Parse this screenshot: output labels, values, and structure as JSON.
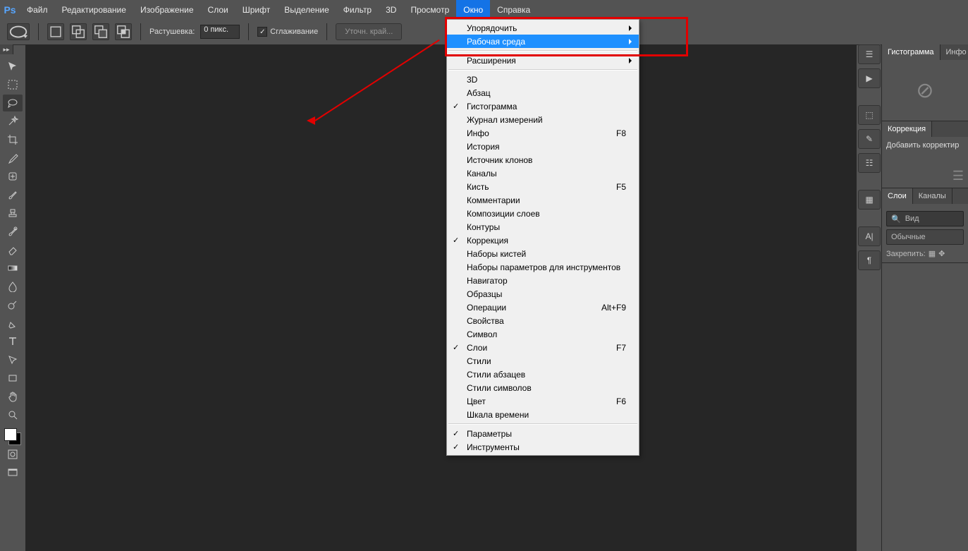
{
  "app_logo": "Ps",
  "menubar": [
    "Файл",
    "Редактирование",
    "Изображение",
    "Слои",
    "Шрифт",
    "Выделение",
    "Фильтр",
    "3D",
    "Просмотр",
    "Окно",
    "Справка"
  ],
  "menubar_active": "Окно",
  "options": {
    "feather_label": "Растушевка:",
    "feather_value": "0 пикс.",
    "antialias_label": "Сглаживание",
    "refine_label": "Уточн. край..."
  },
  "dropdown": {
    "top": [
      {
        "label": "Упорядочить",
        "sub": true
      },
      {
        "label": "Рабочая среда",
        "sub": true,
        "hl": true
      }
    ],
    "ext": {
      "label": "Расширения",
      "sub": true
    },
    "panels": [
      {
        "label": "3D"
      },
      {
        "label": "Абзац"
      },
      {
        "label": "Гистограмма",
        "chk": true
      },
      {
        "label": "Журнал измерений"
      },
      {
        "label": "Инфо",
        "short": "F8"
      },
      {
        "label": "История"
      },
      {
        "label": "Источник клонов"
      },
      {
        "label": "Каналы"
      },
      {
        "label": "Кисть",
        "short": "F5"
      },
      {
        "label": "Комментарии"
      },
      {
        "label": "Композиции слоев"
      },
      {
        "label": "Контуры"
      },
      {
        "label": "Коррекция",
        "chk": true
      },
      {
        "label": "Наборы кистей"
      },
      {
        "label": "Наборы параметров для инструментов"
      },
      {
        "label": "Навигатор"
      },
      {
        "label": "Образцы"
      },
      {
        "label": "Операции",
        "short": "Alt+F9"
      },
      {
        "label": "Свойства"
      },
      {
        "label": "Символ"
      },
      {
        "label": "Слои",
        "chk": true,
        "short": "F7"
      },
      {
        "label": "Стили"
      },
      {
        "label": "Стили абзацев"
      },
      {
        "label": "Стили символов"
      },
      {
        "label": "Цвет",
        "short": "F6"
      },
      {
        "label": "Шкала времени"
      }
    ],
    "bottom": [
      {
        "label": "Параметры",
        "chk": true
      },
      {
        "label": "Инструменты",
        "chk": true
      }
    ]
  },
  "right_panels": {
    "hist": {
      "tab1": "Гистограмма",
      "tab2": "Инфо"
    },
    "adjust": {
      "tab": "Коррекция",
      "hint": "Добавить корректир"
    },
    "layers": {
      "tab1": "Слои",
      "tab2": "Каналы",
      "kind": "Вид",
      "blend": "Обычные",
      "lock": "Закрепить:"
    }
  },
  "tools": [
    "move",
    "marquee",
    "lasso",
    "wand",
    "crop",
    "eyedropper",
    "heal",
    "brush",
    "stamp",
    "history-brush",
    "eraser",
    "gradient",
    "blur",
    "dodge",
    "pen",
    "type",
    "path-sel",
    "rectangle",
    "hand",
    "zoom"
  ]
}
